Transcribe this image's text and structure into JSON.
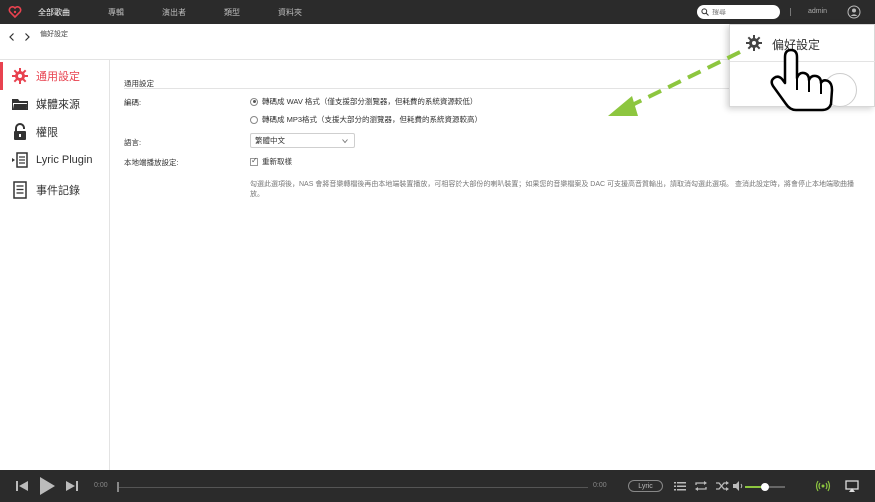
{
  "topbar": {
    "nav": [
      "全部歌曲",
      "專輯",
      "演出者",
      "類型",
      "資料夾"
    ],
    "search_placeholder": "搜尋",
    "user": "admin"
  },
  "breadcrumb": "偏好設定",
  "sidebar": {
    "items": [
      {
        "label": "通用設定",
        "icon": "gear-icon",
        "active": true
      },
      {
        "label": "媒體來源",
        "icon": "folder-icon",
        "active": false
      },
      {
        "label": "權限",
        "icon": "lock-icon",
        "active": false
      },
      {
        "label": "Lyric Plugin",
        "icon": "lyric-icon",
        "active": false
      },
      {
        "label": "事件記錄",
        "icon": "log-icon",
        "active": false
      }
    ]
  },
  "content": {
    "section_title": "通用設定",
    "transcode_label": "編碼:",
    "transcode_options": [
      {
        "label": "轉碼成 WAV 格式（僅支援部分瀏覽器，但耗費的系統資源較低）",
        "selected": true
      },
      {
        "label": "轉碼成 MP3格式（支援大部分的瀏覽器，但耗費的系統資源較高）",
        "selected": false
      }
    ],
    "language_label": "語言:",
    "language_value": "繁體中文",
    "local_playback_label": "本地端播放設定:",
    "restart_label": "重新取樣",
    "note": "勾選此選項後，NAS 會將音樂轉檔後再由本地端裝置播放，可相容於大部份的喇叭裝置；如果您的音樂檔案及 DAC 可支援高音質輸出，請取消勾選此選項。 查消此設定時，將會停止本地端歌曲播放。"
  },
  "popup": {
    "label": "偏好設定"
  },
  "player": {
    "time_start": "0:00",
    "time_end": "0:00",
    "lyric_label": "Lyric",
    "volume": 0.5
  },
  "colors": {
    "accent": "#e8424f",
    "arrow": "#8dc63f",
    "bar": "#2b2b2b"
  }
}
